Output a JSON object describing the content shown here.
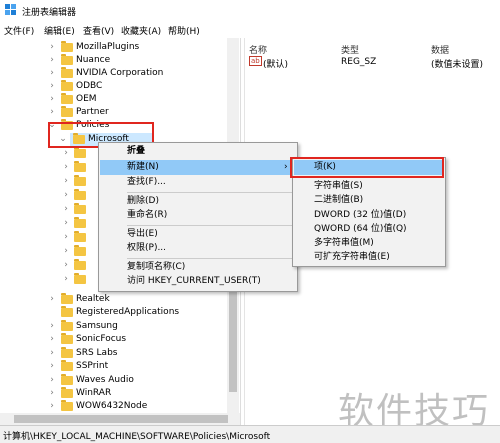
{
  "window": {
    "title": "注册表编辑器"
  },
  "menu": [
    "文件(F)",
    "编辑(E)",
    "查看(V)",
    "收藏夹(A)",
    "帮助(H)"
  ],
  "tree": [
    {
      "label": "MozillaPlugins",
      "expand": "›"
    },
    {
      "label": "Nuance",
      "expand": "›"
    },
    {
      "label": "NVIDIA Corporation",
      "expand": "›"
    },
    {
      "label": "ODBC",
      "expand": "›"
    },
    {
      "label": "OEM",
      "expand": "›"
    },
    {
      "label": "Partner",
      "expand": "›"
    },
    {
      "label": "Policies",
      "expand": "⌄"
    },
    {
      "label": "Microsoft",
      "expand": "⌄"
    },
    {
      "label": "Realtek",
      "expand": "›"
    },
    {
      "label": "RegisteredApplications",
      "expand": ""
    },
    {
      "label": "Samsung",
      "expand": "›"
    },
    {
      "label": "SonicFocus",
      "expand": "›"
    },
    {
      "label": "SRS Labs",
      "expand": "›"
    },
    {
      "label": "SSPrint",
      "expand": "›"
    },
    {
      "label": "Waves Audio",
      "expand": "›"
    },
    {
      "label": "WinRAR",
      "expand": "›"
    },
    {
      "label": "WOW6432Node",
      "expand": "›"
    }
  ],
  "values_pane": {
    "headers": {
      "name": "名称",
      "type": "类型",
      "data": "数据"
    },
    "rows": [
      {
        "icon": "ab",
        "name": "(默认)",
        "type": "REG_SZ",
        "data": "(数值未设置)"
      }
    ]
  },
  "context_menu": {
    "items": [
      "折叠",
      "新建(N)",
      "查找(F)...",
      "删除(D)",
      "重命名(R)",
      "导出(E)",
      "权限(P)...",
      "复制项名称(C)",
      "访问 HKEY_CURRENT_USER(T)"
    ],
    "submenu_arrow": "›"
  },
  "new_submenu": {
    "items": [
      "项(K)",
      "字符串值(S)",
      "二进制值(B)",
      "DWORD (32 位)值(D)",
      "QWORD (64 位)值(Q)",
      "多字符串值(M)",
      "可扩充字符串值(E)"
    ]
  },
  "status": "计算机\\HKEY_LOCAL_MACHINE\\SOFTWARE\\Policies\\Microsoft",
  "watermark": "软件技巧",
  "colors": {
    "highlight": "#cce8ff",
    "menu_highlight": "#91c9f7",
    "annotation": "#e0261f",
    "folder": "#f4c542"
  }
}
